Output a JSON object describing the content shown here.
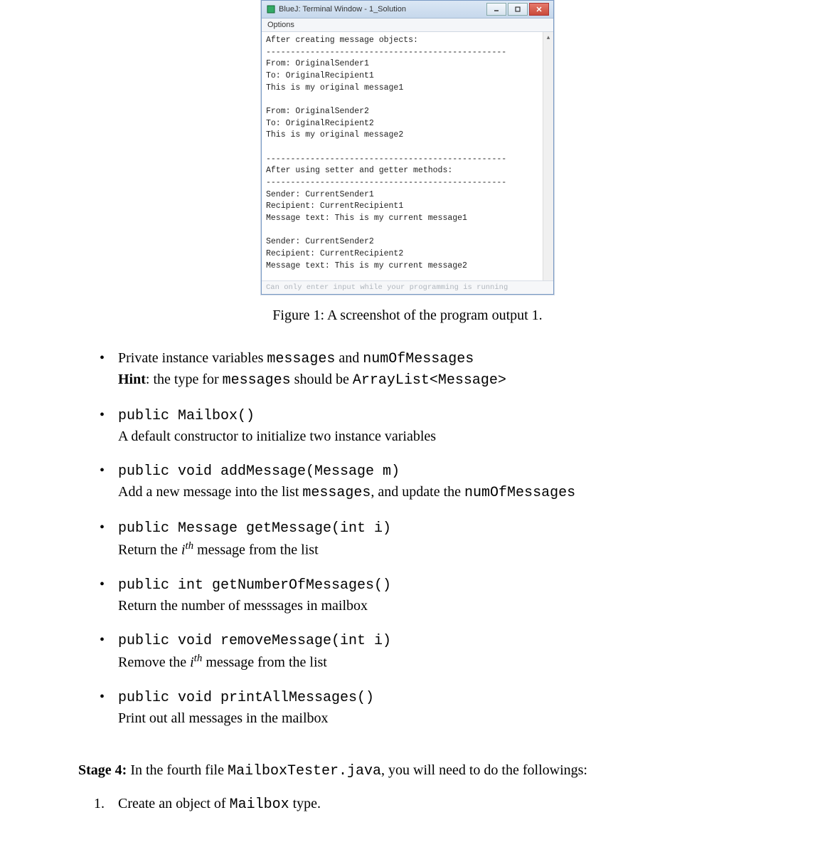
{
  "terminal": {
    "title": "BlueJ: Terminal Window - 1_Solution",
    "menu_options": "Options",
    "output": "After creating message objects:\n-------------------------------------------------\nFrom: OriginalSender1\nTo: OriginalRecipient1\nThis is my original message1\n\nFrom: OriginalSender2\nTo: OriginalRecipient2\nThis is my original message2\n\n-------------------------------------------------\nAfter using setter and getter methods:\n-------------------------------------------------\nSender: CurrentSender1\nRecipient: CurrentRecipient1\nMessage text: This is my current message1\n\nSender: CurrentSender2\nRecipient: CurrentRecipient2\nMessage text: This is my current message2\n",
    "footer": "Can only enter input while your programming is running"
  },
  "figure_caption": "Figure 1: A screenshot of the program output 1.",
  "bullets": {
    "b1": {
      "pre": "Private instance variables ",
      "code1": "messages",
      "mid": " and ",
      "code2": "numOfMessages",
      "line2_bold": "Hint",
      "line2_a": ": the type for ",
      "line2_code1": "messages",
      "line2_b": " should be ",
      "line2_code2": "ArrayList<Message>"
    },
    "b2": {
      "sig": "public Mailbox()",
      "desc": "A default constructor to initialize two instance variables"
    },
    "b3": {
      "sig": "public void addMessage(Message m)",
      "desc_a": "Add a new message into the list ",
      "desc_code1": "messages",
      "desc_b": ", and update the ",
      "desc_code2": "numOfMessages"
    },
    "b4": {
      "sig": "public Message getMessage(int i)",
      "desc_a": "Return the ",
      "desc_i": "i",
      "desc_th": "th",
      "desc_b": " message from the list"
    },
    "b5": {
      "sig": "public int getNumberOfMessages()",
      "desc": "Return the number of messsages in mailbox"
    },
    "b6": {
      "sig": "public void removeMessage(int i)",
      "desc_a": "Remove the ",
      "desc_i": "i",
      "desc_th": "th",
      "desc_b": " message from the list"
    },
    "b7": {
      "sig": "public void printAllMessages()",
      "desc": "Print out all messages in the mailbox"
    }
  },
  "stage4": {
    "label": "Stage 4:",
    "text_a": " In the fourth file ",
    "code": "MailboxTester.java",
    "text_b": ", you will need to do the followings:"
  },
  "ordered": {
    "item1": {
      "num": "1.",
      "text_a": "Create an object of ",
      "code": "Mailbox",
      "text_b": " type."
    }
  }
}
